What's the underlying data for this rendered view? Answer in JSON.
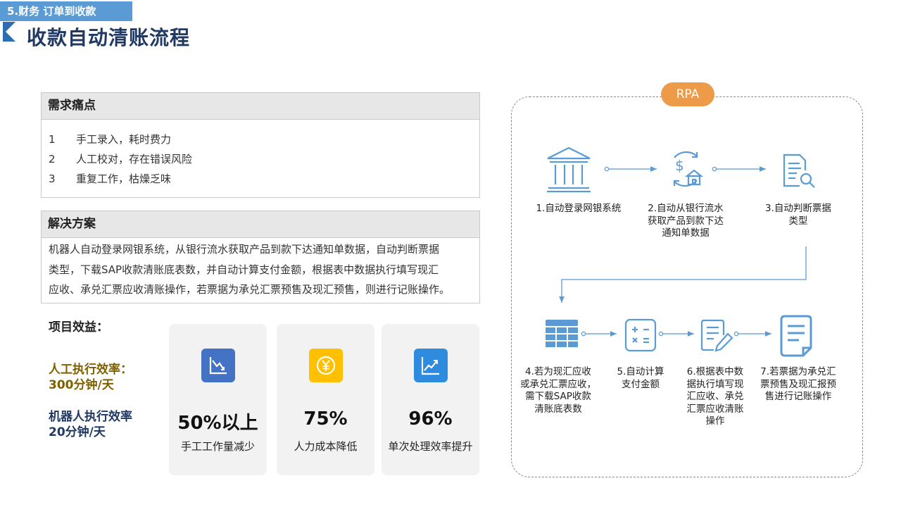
{
  "header": {
    "section_tag": "5.财务 订单到收款",
    "title": "收款自动清账流程"
  },
  "pain_points": {
    "title": "需求痛点",
    "items": [
      {
        "num": "1",
        "text": "手工录入，耗时费力"
      },
      {
        "num": "2",
        "text": "人工校对，存在错误风险"
      },
      {
        "num": "3",
        "text": "重复工作，枯燥乏味"
      }
    ]
  },
  "solution": {
    "title": "解决方案",
    "lines": [
      "机器人自动登录网银系统，从银行流水获取产品到款下达通知单数据，自动判断票据",
      "类型，下载SAP收款清账底表数，并自动计算支付金额，根据表中数据执行填写现汇",
      "应收、承兑汇票应收清账操作，若票据为承兑汇票预售及现汇预售，则进行记账操作。"
    ]
  },
  "benefits": {
    "title": "项目效益：",
    "manual": {
      "line1": "人工执行效率：",
      "line2": "300分钟/天"
    },
    "robot": {
      "line1": "机器人执行效率",
      "line2": "20分钟/天"
    },
    "cards": [
      {
        "value": "50%以上",
        "label": "手工工作量减少",
        "icon": "chart-down-icon",
        "color": "#4472c4"
      },
      {
        "value": "75%",
        "label": "人力成本降低",
        "icon": "yen-coin-icon",
        "color": "#ffc000"
      },
      {
        "value": "96%",
        "label": "单次处理效率提升",
        "icon": "chart-up-icon",
        "color": "#2e8bde"
      }
    ]
  },
  "flow": {
    "badge": "RPA",
    "accent": "#5b9bd5",
    "steps": [
      {
        "icon": "bank-icon",
        "lines": [
          "1.自动登录网银系统"
        ]
      },
      {
        "icon": "money-exchange-icon",
        "lines": [
          "2.自动从银行流水",
          "获取产品到款下达",
          "通知单数据"
        ]
      },
      {
        "icon": "document-search-icon",
        "lines": [
          "3.自动判断票据",
          "类型"
        ]
      },
      {
        "icon": "spreadsheet-icon",
        "lines": [
          "4.若为现汇应收",
          "或承兑汇票应收，",
          "需下载SAP收款",
          "清账底表数"
        ]
      },
      {
        "icon": "calculator-icon",
        "lines": [
          "5.自动计算",
          "支付金额"
        ]
      },
      {
        "icon": "form-edit-icon",
        "lines": [
          "6.根据表中数",
          "据执行填写现",
          "汇应收、承兑",
          "汇票应收清账",
          "操作"
        ]
      },
      {
        "icon": "document-icon",
        "lines": [
          "7.若票据为承兑汇",
          "票预售及现汇报预",
          "售进行记账操作"
        ]
      }
    ]
  }
}
